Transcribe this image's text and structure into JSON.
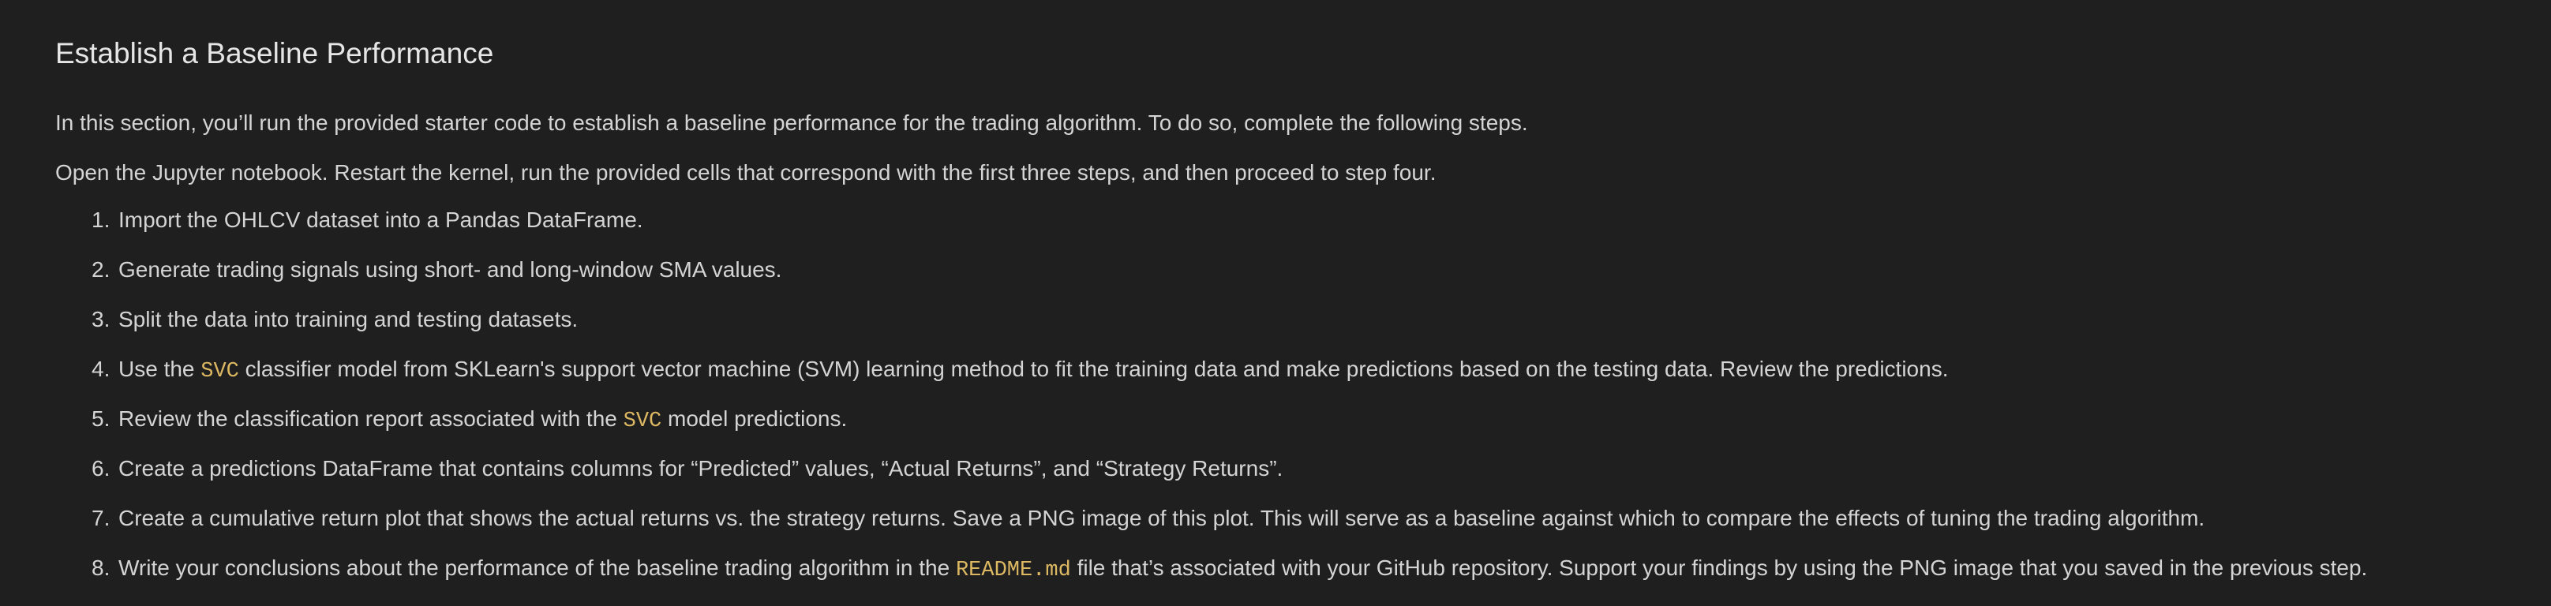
{
  "section": {
    "title": "Establish a Baseline Performance",
    "intro": "In this section, you’ll run the provided starter code to establish a baseline performance for the trading algorithm. To do so, complete the following steps.",
    "instructions": "Open the Jupyter notebook. Restart the kernel, run the provided cells that correspond with the first three steps, and then proceed to step four."
  },
  "steps": [
    {
      "num": "1.",
      "text": "Import the OHLCV dataset into a Pandas DataFrame."
    },
    {
      "num": "2.",
      "text": "Generate trading signals using short- and long-window SMA values."
    },
    {
      "num": "3.",
      "text": "Split the data into training and testing datasets."
    },
    {
      "num": "4.",
      "before": "Use the ",
      "code": "SVC",
      "after": " classifier model from SKLearn's support vector machine (SVM) learning method to fit the training data and make predictions based on the testing data. Review the predictions."
    },
    {
      "num": "5.",
      "before": "Review the classification report associated with the ",
      "code": "SVC",
      "after": " model predictions."
    },
    {
      "num": "6.",
      "text": "Create a predictions DataFrame that contains columns for “Predicted” values, “Actual Returns”, and “Strategy Returns”."
    },
    {
      "num": "7.",
      "text": "Create a cumulative return plot that shows the actual returns vs. the strategy returns. Save a PNG image of this plot. This will serve as a baseline against which to compare the effects of tuning the trading algorithm."
    },
    {
      "num": "8.",
      "before": "Write your conclusions about the performance of the baseline trading algorithm in the ",
      "code": "README.md",
      "after": " file that’s associated with your GitHub repository. Support your findings by using the PNG image that you saved in the previous step."
    }
  ],
  "colors": {
    "background": "#1f1f1f",
    "text": "#d4d4d4",
    "code": "#dcb862"
  }
}
